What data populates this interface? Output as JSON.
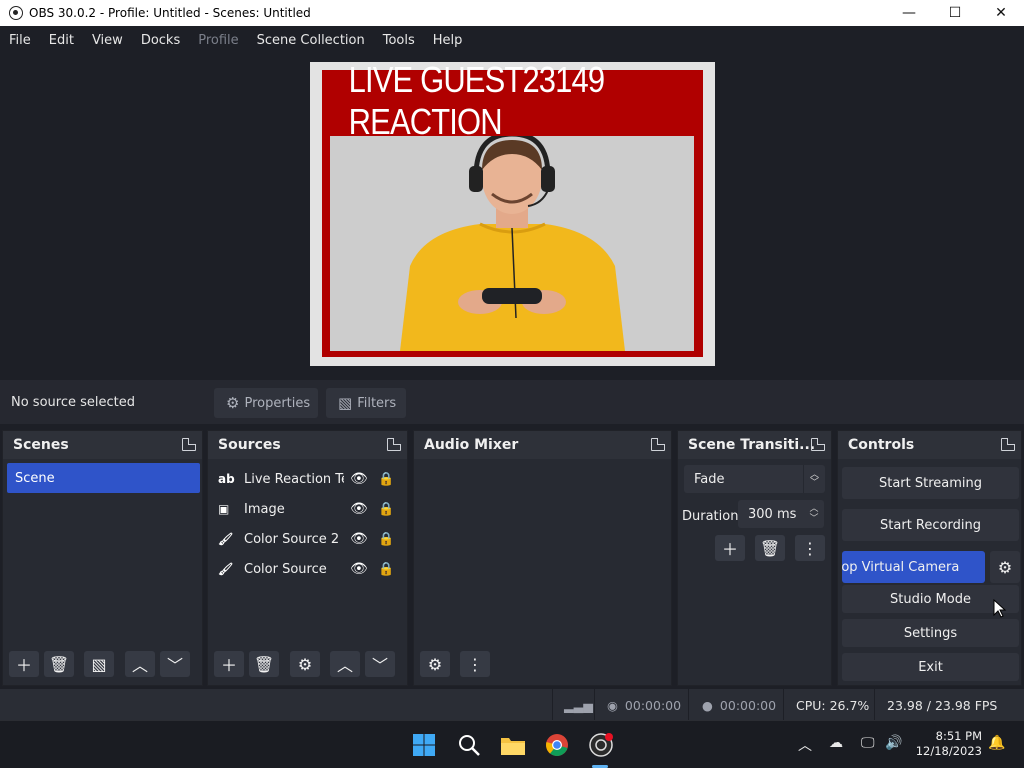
{
  "window": {
    "title": "OBS 30.0.2 - Profile: Untitled - Scenes: Untitled",
    "minimize": "—",
    "maximize": "☐",
    "close": "✕"
  },
  "menu": [
    "File",
    "Edit",
    "View",
    "Docks",
    "Profile",
    "Scene Collection",
    "Tools",
    "Help"
  ],
  "preview": {
    "banner_text": "LIVE GUEST23149 REACTION"
  },
  "source_bar": {
    "status": "No source selected",
    "properties_label": "Properties",
    "filters_label": "Filters"
  },
  "docks": {
    "scenes": {
      "title": "Scenes",
      "items": [
        "Scene"
      ]
    },
    "sources": {
      "title": "Sources",
      "items": [
        {
          "label": "Live Reaction Text",
          "icon": "text-icon"
        },
        {
          "label": "Image",
          "icon": "image-icon"
        },
        {
          "label": "Color Source 2",
          "icon": "brush-icon"
        },
        {
          "label": "Color Source",
          "icon": "brush-icon"
        }
      ]
    },
    "audio_mixer": {
      "title": "Audio Mixer"
    },
    "transitions": {
      "title": "Scene Transiti...",
      "selected": "Fade",
      "duration_label": "Duration",
      "duration_value": "300 ms"
    },
    "controls": {
      "title": "Controls",
      "start_streaming": "Start Streaming",
      "start_recording": "Start Recording",
      "stop_virtual_camera": "Stop Virtual Camera",
      "studio_mode": "Studio Mode",
      "settings": "Settings",
      "exit": "Exit"
    }
  },
  "status": {
    "stream_time": "00:00:00",
    "record_time": "00:00:00",
    "cpu": "CPU: 26.7%",
    "fps": "23.98 / 23.98 FPS"
  },
  "taskbar": {
    "time": "8:51 PM",
    "date": "12/18/2023"
  },
  "colors": {
    "accent": "#2f54c9",
    "banner_red": "#b00000",
    "panel": "#2a2d35",
    "background": "#1d1f26"
  }
}
